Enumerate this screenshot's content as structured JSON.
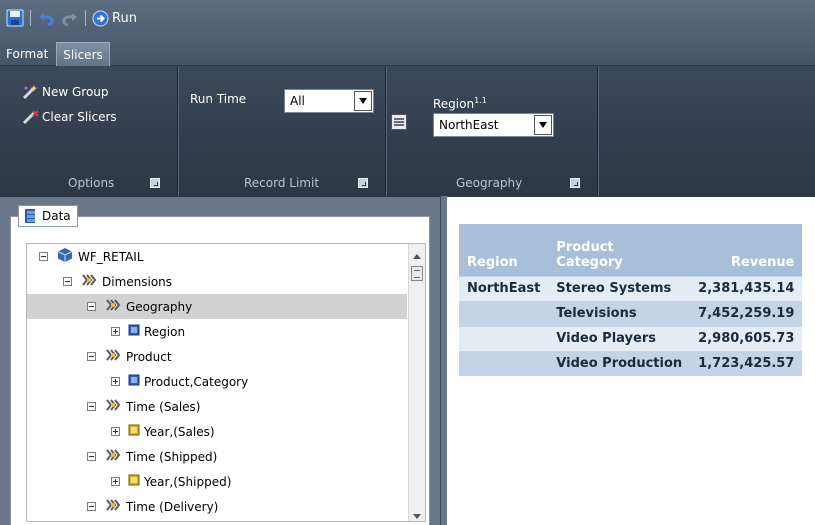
{
  "toolbar": {
    "save_icon": "save-icon",
    "undo_icon": "undo-icon",
    "redo_icon": "redo-icon",
    "run_label": "Run"
  },
  "tabs": [
    {
      "label": "Format",
      "active": false
    },
    {
      "label": "Slicers",
      "active": true
    }
  ],
  "ribbon": {
    "options": {
      "label": "Options",
      "new_group": "New Group",
      "clear_slicers": "Clear Slicers"
    },
    "record_limit": {
      "label": "Record Limit",
      "run_time_label": "Run Time",
      "run_time_value": "All"
    },
    "geography": {
      "label": "Geography",
      "region_label": "Region",
      "region_superscript": "1.1",
      "region_value": "NorthEast"
    }
  },
  "data_panel": {
    "title": "Data",
    "tree": [
      {
        "label": "WF_RETAIL",
        "level": 0,
        "expander": "minus",
        "icon": "cube-icon",
        "selected": false
      },
      {
        "label": "Dimensions",
        "level": 1,
        "expander": "minus",
        "icon": "dimension-icon",
        "selected": false
      },
      {
        "label": "Geography",
        "level": 2,
        "expander": "minus",
        "icon": "dimension-icon",
        "selected": true
      },
      {
        "label": "Region",
        "level": 3,
        "expander": "plus",
        "icon": "hierarchy-blue-icon",
        "selected": false
      },
      {
        "label": "Product",
        "level": 2,
        "expander": "minus",
        "icon": "dimension-icon",
        "selected": false
      },
      {
        "label": "Product,Category",
        "level": 3,
        "expander": "plus",
        "icon": "hierarchy-blue-icon",
        "selected": false
      },
      {
        "label": "Time (Sales)",
        "level": 2,
        "expander": "minus",
        "icon": "dimension-icon",
        "selected": false
      },
      {
        "label": "Year,(Sales)",
        "level": 3,
        "expander": "plus",
        "icon": "hierarchy-yellow-icon",
        "selected": false
      },
      {
        "label": "Time (Shipped)",
        "level": 2,
        "expander": "minus",
        "icon": "dimension-icon",
        "selected": false
      },
      {
        "label": "Year,(Shipped)",
        "level": 3,
        "expander": "plus",
        "icon": "hierarchy-yellow-icon",
        "selected": false
      },
      {
        "label": "Time (Delivery)",
        "level": 2,
        "expander": "minus",
        "icon": "dimension-icon",
        "selected": false
      }
    ]
  },
  "report": {
    "headers": {
      "region": "Region",
      "product_line1": "Product",
      "product_line2": "Category",
      "revenue": "Revenue"
    },
    "rows": [
      {
        "region": "NorthEast",
        "category": "Stereo Systems",
        "revenue": "2,381,435.14"
      },
      {
        "region": "",
        "category": "Televisions",
        "revenue": "7,452,259.19"
      },
      {
        "region": "",
        "category": "Video Players",
        "revenue": "2,980,605.73"
      },
      {
        "region": "",
        "category": "Video Production",
        "revenue": "1,723,425.57"
      }
    ]
  }
}
